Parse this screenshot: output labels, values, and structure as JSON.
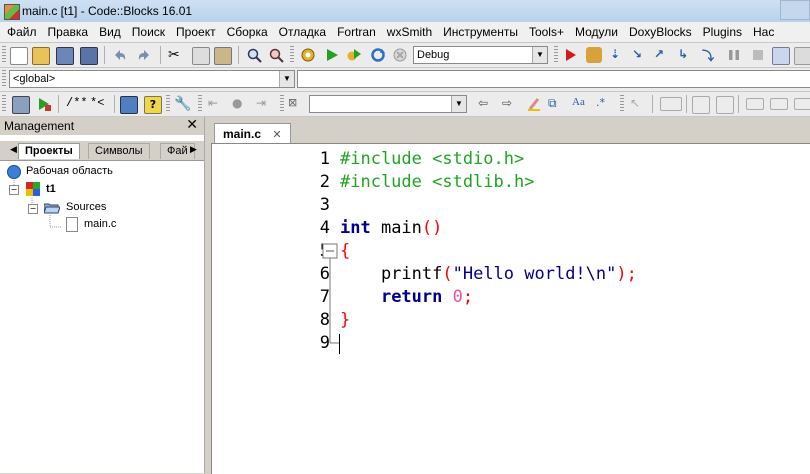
{
  "window": {
    "title": "main.c [t1] - Code::Blocks 16.01"
  },
  "menu": [
    "Файл",
    "Правка",
    "Вид",
    "Поиск",
    "Проект",
    "Сборка",
    "Отладка",
    "Fortran",
    "wxSmith",
    "Инструменты",
    "Tools+",
    "Модули",
    "DoxyBlocks",
    "Plugins",
    "Нас"
  ],
  "toolbar": {
    "build_target": "Debug",
    "scope": "<global>",
    "doxy_comment_block": "/**",
    "doxy_line_comment": "*<"
  },
  "management": {
    "title": "Management",
    "tabs": [
      "Проекты",
      "Символы",
      "Фай"
    ],
    "tree": {
      "workspace": "Рабочая область",
      "project": "t1",
      "folder": "Sources",
      "file": "main.c"
    }
  },
  "editor": {
    "tab_label": "main.c",
    "line_numbers": [
      "1",
      "2",
      "3",
      "4",
      "5",
      "6",
      "7",
      "8",
      "9"
    ],
    "code": [
      [
        {
          "t": "#include <stdio.h>",
          "c": "pp"
        }
      ],
      [
        {
          "t": "#include <stdlib.h>",
          "c": "pp"
        }
      ],
      [],
      [
        {
          "t": "int",
          "c": "kw"
        },
        {
          "t": " main",
          "c": "id"
        },
        {
          "t": "()",
          "c": "op"
        }
      ],
      [
        {
          "t": "{",
          "c": "op"
        }
      ],
      [
        {
          "t": "    printf",
          "c": "id"
        },
        {
          "t": "(",
          "c": "op"
        },
        {
          "t": "\"Hello world!\\n\"",
          "c": "str"
        },
        {
          "t": ");",
          "c": "op"
        }
      ],
      [
        {
          "t": "    ",
          "c": "id"
        },
        {
          "t": "return",
          "c": "kw"
        },
        {
          "t": " ",
          "c": "id"
        },
        {
          "t": "0",
          "c": "num"
        },
        {
          "t": ";",
          "c": "op"
        }
      ],
      [
        {
          "t": "}",
          "c": "op"
        }
      ],
      []
    ]
  }
}
